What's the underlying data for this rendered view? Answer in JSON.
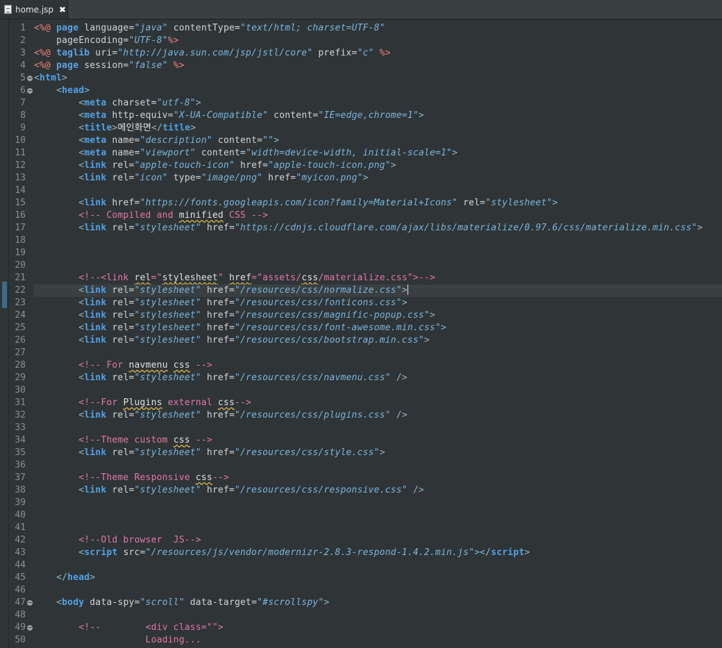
{
  "tab": {
    "title": "home.jsp",
    "close_glyph": "✖",
    "icon": "jsp-file-icon"
  },
  "editor": {
    "current_line": 22,
    "change_markers": [
      22
    ],
    "lines": [
      {
        "n": "1",
        "fold": false,
        "tokens": [
          [
            "pi",
            "<%@ "
          ],
          [
            "kw",
            "page "
          ],
          [
            "at",
            "language="
          ],
          [
            "vl",
            "\"java\""
          ],
          [
            "at",
            " contentType="
          ],
          [
            "vl",
            "\"text/html; charset=UTF-8\""
          ]
        ]
      },
      {
        "n": "2",
        "fold": false,
        "tokens": [
          [
            "at",
            "    pageEncoding="
          ],
          [
            "vl",
            "\"UTF-8\""
          ],
          [
            "pi",
            "%>"
          ]
        ]
      },
      {
        "n": "3",
        "fold": false,
        "tokens": [
          [
            "pi",
            "<%@ "
          ],
          [
            "kw",
            "taglib "
          ],
          [
            "at",
            "uri="
          ],
          [
            "vl",
            "\"http://java.sun.com/jsp/jstl/core\""
          ],
          [
            "at",
            " prefix="
          ],
          [
            "vl",
            "\"c\""
          ],
          [
            "pi",
            " %>"
          ]
        ]
      },
      {
        "n": "4",
        "fold": false,
        "tokens": [
          [
            "pi",
            "<%@ "
          ],
          [
            "kw",
            "page "
          ],
          [
            "at",
            "session="
          ],
          [
            "vl",
            "\"false\""
          ],
          [
            "pi",
            " %>"
          ]
        ]
      },
      {
        "n": "5",
        "fold": true,
        "tokens": [
          [
            "br",
            "<"
          ],
          [
            "tg",
            "html"
          ],
          [
            "br",
            ">"
          ]
        ]
      },
      {
        "n": "6",
        "fold": true,
        "tokens": [
          [
            "tx",
            "    "
          ],
          [
            "br",
            "<"
          ],
          [
            "tg",
            "head"
          ],
          [
            "br",
            ">"
          ]
        ]
      },
      {
        "n": "7",
        "fold": false,
        "tokens": [
          [
            "tx",
            "        "
          ],
          [
            "br",
            "<"
          ],
          [
            "tg",
            "meta "
          ],
          [
            "at",
            "charset="
          ],
          [
            "vl",
            "\"utf-8\""
          ],
          [
            "br",
            ">"
          ]
        ]
      },
      {
        "n": "8",
        "fold": false,
        "tokens": [
          [
            "tx",
            "        "
          ],
          [
            "br",
            "<"
          ],
          [
            "tg",
            "meta "
          ],
          [
            "at",
            "http-equiv="
          ],
          [
            "vl",
            "\"X-UA-Compatible\""
          ],
          [
            "at",
            " content="
          ],
          [
            "vl",
            "\"IE=edge,chrome=1\""
          ],
          [
            "br",
            ">"
          ]
        ]
      },
      {
        "n": "9",
        "fold": false,
        "tokens": [
          [
            "tx",
            "        "
          ],
          [
            "br",
            "<"
          ],
          [
            "tg",
            "title"
          ],
          [
            "br",
            ">"
          ],
          [
            "tx",
            "메인화면"
          ],
          [
            "br",
            "</"
          ],
          [
            "tg",
            "title"
          ],
          [
            "br",
            ">"
          ]
        ]
      },
      {
        "n": "10",
        "fold": false,
        "tokens": [
          [
            "tx",
            "        "
          ],
          [
            "br",
            "<"
          ],
          [
            "tg",
            "meta "
          ],
          [
            "at",
            "name="
          ],
          [
            "vl",
            "\"description\""
          ],
          [
            "at",
            " content="
          ],
          [
            "vl",
            "\"\""
          ],
          [
            "br",
            ">"
          ]
        ]
      },
      {
        "n": "11",
        "fold": false,
        "tokens": [
          [
            "tx",
            "        "
          ],
          [
            "br",
            "<"
          ],
          [
            "tg",
            "meta "
          ],
          [
            "at",
            "name="
          ],
          [
            "vl",
            "\"viewport\""
          ],
          [
            "at",
            " content="
          ],
          [
            "vl",
            "\"width=device-width, initial-scale=1\""
          ],
          [
            "br",
            ">"
          ]
        ]
      },
      {
        "n": "12",
        "fold": false,
        "tokens": [
          [
            "tx",
            "        "
          ],
          [
            "br",
            "<"
          ],
          [
            "tg",
            "link "
          ],
          [
            "at",
            "rel="
          ],
          [
            "vl",
            "\"apple-touch-icon\""
          ],
          [
            "at",
            " href="
          ],
          [
            "vl",
            "\"apple-touch-icon.png\""
          ],
          [
            "br",
            ">"
          ]
        ]
      },
      {
        "n": "13",
        "fold": false,
        "tokens": [
          [
            "tx",
            "        "
          ],
          [
            "br",
            "<"
          ],
          [
            "tg",
            "link "
          ],
          [
            "at",
            "rel="
          ],
          [
            "vl",
            "\"icon\""
          ],
          [
            "at",
            " type="
          ],
          [
            "vl",
            "\"image/png\""
          ],
          [
            "at",
            " href="
          ],
          [
            "vl",
            "\"myicon.png\""
          ],
          [
            "br",
            ">"
          ]
        ]
      },
      {
        "n": "14",
        "fold": false,
        "tokens": []
      },
      {
        "n": "15",
        "fold": false,
        "tokens": [
          [
            "tx",
            "        "
          ],
          [
            "br",
            "<"
          ],
          [
            "tg",
            "link "
          ],
          [
            "at",
            "href="
          ],
          [
            "vl",
            "\"https://fonts.googleapis.com/icon?family=Material+Icons\""
          ],
          [
            "at",
            " rel="
          ],
          [
            "vl",
            "\"stylesheet\""
          ],
          [
            "br",
            ">"
          ]
        ]
      },
      {
        "n": "16",
        "fold": false,
        "tokens": [
          [
            "tx",
            "        "
          ],
          [
            "cm",
            "<!-- Compiled and "
          ],
          [
            "sq",
            "minified"
          ],
          [
            "cm",
            " CSS -->"
          ]
        ]
      },
      {
        "n": "17",
        "fold": false,
        "tokens": [
          [
            "tx",
            "        "
          ],
          [
            "br",
            "<"
          ],
          [
            "tg",
            "link "
          ],
          [
            "at",
            "rel="
          ],
          [
            "vl",
            "\"stylesheet\""
          ],
          [
            "at",
            " href="
          ],
          [
            "vl",
            "\"https://cdnjs.cloudflare.com/ajax/libs/materialize/0.97.6/css/materialize.min.css\""
          ],
          [
            "br",
            ">"
          ]
        ]
      },
      {
        "n": "18",
        "fold": false,
        "tokens": []
      },
      {
        "n": "19",
        "fold": false,
        "tokens": []
      },
      {
        "n": "20",
        "fold": false,
        "tokens": []
      },
      {
        "n": "21",
        "fold": false,
        "tokens": [
          [
            "tx",
            "        "
          ],
          [
            "cm",
            "<!--<link "
          ],
          [
            "sq",
            "rel"
          ],
          [
            "cm",
            "=\""
          ],
          [
            "sq",
            "stylesheet"
          ],
          [
            "cm",
            "\" "
          ],
          [
            "sq",
            "href"
          ],
          [
            "cm",
            "=\"assets/"
          ],
          [
            "sq",
            "css"
          ],
          [
            "cm",
            "/materialize.css\">-->"
          ]
        ]
      },
      {
        "n": "22",
        "fold": false,
        "tokens": [
          [
            "tx",
            "        "
          ],
          [
            "br",
            "<"
          ],
          [
            "tg",
            "link "
          ],
          [
            "at",
            "rel="
          ],
          [
            "vl",
            "\"stylesheet\""
          ],
          [
            "at",
            " href="
          ],
          [
            "vl",
            "\"/resources/css/normalize.css\""
          ],
          [
            "br",
            ">"
          ],
          [
            "caret",
            ""
          ]
        ]
      },
      {
        "n": "23",
        "fold": false,
        "tokens": [
          [
            "tx",
            "        "
          ],
          [
            "br",
            "<"
          ],
          [
            "tg",
            "link "
          ],
          [
            "at",
            "rel="
          ],
          [
            "vl",
            "\"stylesheet\""
          ],
          [
            "at",
            " href="
          ],
          [
            "vl",
            "\"/resources/css/fonticons.css\""
          ],
          [
            "br",
            ">"
          ]
        ]
      },
      {
        "n": "24",
        "fold": false,
        "tokens": [
          [
            "tx",
            "        "
          ],
          [
            "br",
            "<"
          ],
          [
            "tg",
            "link "
          ],
          [
            "at",
            "rel="
          ],
          [
            "vl",
            "\"stylesheet\""
          ],
          [
            "at",
            " href="
          ],
          [
            "vl",
            "\"/resources/css/magnific-popup.css\""
          ],
          [
            "br",
            ">"
          ]
        ]
      },
      {
        "n": "25",
        "fold": false,
        "tokens": [
          [
            "tx",
            "        "
          ],
          [
            "br",
            "<"
          ],
          [
            "tg",
            "link "
          ],
          [
            "at",
            "rel="
          ],
          [
            "vl",
            "\"stylesheet\""
          ],
          [
            "at",
            " href="
          ],
          [
            "vl",
            "\"/resources/css/font-awesome.min.css\""
          ],
          [
            "br",
            ">"
          ]
        ]
      },
      {
        "n": "26",
        "fold": false,
        "tokens": [
          [
            "tx",
            "        "
          ],
          [
            "br",
            "<"
          ],
          [
            "tg",
            "link "
          ],
          [
            "at",
            "rel="
          ],
          [
            "vl",
            "\"stylesheet\""
          ],
          [
            "at",
            " href="
          ],
          [
            "vl",
            "\"/resources/css/bootstrap.min.css\""
          ],
          [
            "br",
            ">"
          ]
        ]
      },
      {
        "n": "27",
        "fold": false,
        "tokens": []
      },
      {
        "n": "28",
        "fold": false,
        "tokens": [
          [
            "tx",
            "        "
          ],
          [
            "cm",
            "<!-- For "
          ],
          [
            "sq",
            "navmenu"
          ],
          [
            "cm",
            " "
          ],
          [
            "sq",
            "css"
          ],
          [
            "cm",
            " -->"
          ]
        ]
      },
      {
        "n": "29",
        "fold": false,
        "tokens": [
          [
            "tx",
            "        "
          ],
          [
            "br",
            "<"
          ],
          [
            "tg",
            "link "
          ],
          [
            "at",
            "rel="
          ],
          [
            "vl",
            "\"stylesheet\""
          ],
          [
            "at",
            " href="
          ],
          [
            "vl",
            "\"/resources/css/navmenu.css\""
          ],
          [
            "br",
            " />"
          ]
        ]
      },
      {
        "n": "30",
        "fold": false,
        "tokens": []
      },
      {
        "n": "31",
        "fold": false,
        "tokens": [
          [
            "tx",
            "        "
          ],
          [
            "cm",
            "<!--For "
          ],
          [
            "sq",
            "Plugins"
          ],
          [
            "cm",
            " external "
          ],
          [
            "sq",
            "css"
          ],
          [
            "cm",
            "-->"
          ]
        ]
      },
      {
        "n": "32",
        "fold": false,
        "tokens": [
          [
            "tx",
            "        "
          ],
          [
            "br",
            "<"
          ],
          [
            "tg",
            "link "
          ],
          [
            "at",
            "rel="
          ],
          [
            "vl",
            "\"stylesheet\""
          ],
          [
            "at",
            " href="
          ],
          [
            "vl",
            "\"/resources/css/plugins.css\""
          ],
          [
            "br",
            " />"
          ]
        ]
      },
      {
        "n": "33",
        "fold": false,
        "tokens": []
      },
      {
        "n": "34",
        "fold": false,
        "tokens": [
          [
            "tx",
            "        "
          ],
          [
            "cm",
            "<!--Theme custom "
          ],
          [
            "sq",
            "css"
          ],
          [
            "cm",
            " -->"
          ]
        ]
      },
      {
        "n": "35",
        "fold": false,
        "tokens": [
          [
            "tx",
            "        "
          ],
          [
            "br",
            "<"
          ],
          [
            "tg",
            "link "
          ],
          [
            "at",
            "rel="
          ],
          [
            "vl",
            "\"stylesheet\""
          ],
          [
            "at",
            " href="
          ],
          [
            "vl",
            "\"/resources/css/style.css\""
          ],
          [
            "br",
            ">"
          ]
        ]
      },
      {
        "n": "36",
        "fold": false,
        "tokens": []
      },
      {
        "n": "37",
        "fold": false,
        "tokens": [
          [
            "tx",
            "        "
          ],
          [
            "cm",
            "<!--Theme Responsive "
          ],
          [
            "sq",
            "css"
          ],
          [
            "cm",
            "-->"
          ]
        ]
      },
      {
        "n": "38",
        "fold": false,
        "tokens": [
          [
            "tx",
            "        "
          ],
          [
            "br",
            "<"
          ],
          [
            "tg",
            "link "
          ],
          [
            "at",
            "rel="
          ],
          [
            "vl",
            "\"stylesheet\""
          ],
          [
            "at",
            " href="
          ],
          [
            "vl",
            "\"/resources/css/responsive.css\""
          ],
          [
            "br",
            " />"
          ]
        ]
      },
      {
        "n": "39",
        "fold": false,
        "tokens": []
      },
      {
        "n": "40",
        "fold": false,
        "tokens": []
      },
      {
        "n": "41",
        "fold": false,
        "tokens": []
      },
      {
        "n": "42",
        "fold": false,
        "tokens": [
          [
            "tx",
            "        "
          ],
          [
            "cm",
            "<!--Old browser  JS-->"
          ]
        ]
      },
      {
        "n": "43",
        "fold": false,
        "tokens": [
          [
            "tx",
            "        "
          ],
          [
            "br",
            "<"
          ],
          [
            "tg",
            "script "
          ],
          [
            "at",
            "src="
          ],
          [
            "vl",
            "\"/resources/js/vendor/modernizr-2.8.3-respond-1.4.2.min.js\""
          ],
          [
            "br",
            "></"
          ],
          [
            "tg",
            "script"
          ],
          [
            "br",
            ">"
          ]
        ]
      },
      {
        "n": "44",
        "fold": false,
        "tokens": []
      },
      {
        "n": "45",
        "fold": false,
        "tokens": [
          [
            "tx",
            "    "
          ],
          [
            "br",
            "</"
          ],
          [
            "tg",
            "head"
          ],
          [
            "br",
            ">"
          ]
        ]
      },
      {
        "n": "46",
        "fold": false,
        "tokens": []
      },
      {
        "n": "47",
        "fold": true,
        "tokens": [
          [
            "tx",
            "    "
          ],
          [
            "br",
            "<"
          ],
          [
            "tg",
            "body "
          ],
          [
            "at",
            "data-spy="
          ],
          [
            "vl",
            "\"scroll\""
          ],
          [
            "at",
            " data-target="
          ],
          [
            "vl",
            "\"#scrollspy\""
          ],
          [
            "br",
            ">"
          ]
        ]
      },
      {
        "n": "48",
        "fold": false,
        "tokens": []
      },
      {
        "n": "49",
        "fold": true,
        "tokens": [
          [
            "tx",
            "        "
          ],
          [
            "cm",
            "<!--        <div class=\"\">"
          ]
        ]
      },
      {
        "n": "50",
        "fold": false,
        "tokens": [
          [
            "tx",
            "                    "
          ],
          [
            "cm",
            "Loading..."
          ]
        ]
      }
    ]
  }
}
